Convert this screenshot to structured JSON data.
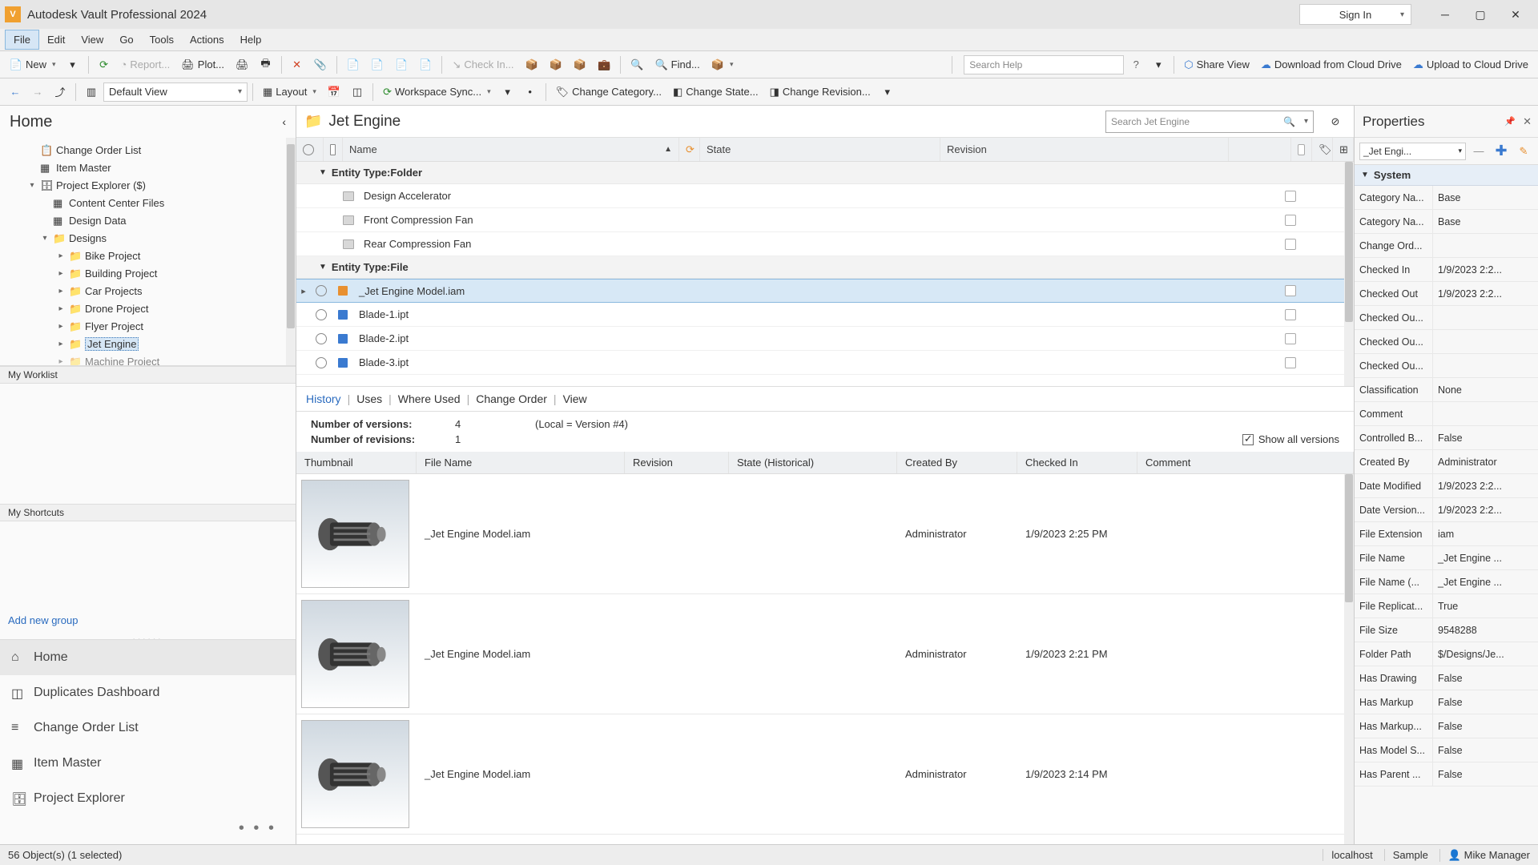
{
  "app": {
    "title": "Autodesk Vault Professional 2024",
    "signin": "Sign In"
  },
  "menu": {
    "file": "File",
    "edit": "Edit",
    "view": "View",
    "go": "Go",
    "tools": "Tools",
    "actions": "Actions",
    "help": "Help"
  },
  "toolbar": {
    "new": "New",
    "report": "Report...",
    "plot": "Plot...",
    "checkin": "Check In...",
    "find": "Find...",
    "search_help_ph": "Search Help",
    "share_view": "Share View",
    "download_cloud": "Download from Cloud Drive",
    "upload_cloud": "Upload to Cloud Drive"
  },
  "toolbar2": {
    "view_select": "Default View",
    "layout": "Layout",
    "workspace_sync": "Workspace Sync...",
    "change_category": "Change Category...",
    "change_state": "Change State...",
    "change_revision": "Change Revision..."
  },
  "left": {
    "home": "Home",
    "tree": {
      "col": "Change Order List",
      "item_master": "Item Master",
      "proj_explorer": "Project Explorer ($)",
      "content_center": "Content Center Files",
      "design_data": "Design Data",
      "designs": "Designs",
      "bike": "Bike Project",
      "building": "Building Project",
      "car": "Car Projects",
      "drone": "Drone Project",
      "flyer": "Flyer Project",
      "jet": "Jet Engine",
      "machine": "Machine Project"
    },
    "worklist": "My Worklist",
    "shortcuts": "My Shortcuts",
    "add_group": "Add new group",
    "nav": {
      "home": "Home",
      "dup": "Duplicates Dashboard",
      "col": "Change Order List",
      "item": "Item Master",
      "proj": "Project Explorer"
    }
  },
  "center": {
    "title": "Jet Engine",
    "search_ph": "Search Jet Engine",
    "cols": {
      "name": "Name",
      "state": "State",
      "revision": "Revision"
    },
    "groups": {
      "folder": "Entity Type:Folder",
      "file": "Entity Type:File"
    },
    "rows": {
      "design_accel": "Design Accelerator",
      "front_fan": "Front Compression Fan",
      "rear_fan": "Rear Compression Fan",
      "jet_model": "_Jet Engine Model.iam",
      "blade1": "Blade-1.ipt",
      "blade2": "Blade-2.ipt",
      "blade3": "Blade-3.ipt"
    },
    "tabs": {
      "history": "History",
      "uses": "Uses",
      "where_used": "Where Used",
      "change_order": "Change Order",
      "view": "View"
    },
    "meta": {
      "versions_lbl": "Number of versions:",
      "versions_val": "4",
      "local_version": "(Local = Version #4)",
      "revisions_lbl": "Number of revisions:",
      "revisions_val": "1",
      "show_all": "Show all versions"
    },
    "hist_cols": {
      "thumb": "Thumbnail",
      "file": "File Name",
      "rev": "Revision",
      "state": "State (Historical)",
      "created_by": "Created By",
      "checked_in": "Checked In",
      "comment": "Comment"
    },
    "hist": [
      {
        "file": "_Jet Engine Model.iam",
        "by": "Administrator",
        "checked_in": "1/9/2023 2:25 PM"
      },
      {
        "file": "_Jet Engine Model.iam",
        "by": "Administrator",
        "checked_in": "1/9/2023 2:21 PM"
      },
      {
        "file": "_Jet Engine Model.iam",
        "by": "Administrator",
        "checked_in": "1/9/2023 2:14 PM"
      }
    ]
  },
  "props": {
    "title": "Properties",
    "selected": "_Jet Engi...",
    "system": "System",
    "rows": [
      {
        "n": "Category Na...",
        "v": "Base"
      },
      {
        "n": "Category Na...",
        "v": "Base"
      },
      {
        "n": "Change Ord...",
        "v": ""
      },
      {
        "n": "Checked In",
        "v": "1/9/2023 2:2..."
      },
      {
        "n": "Checked Out",
        "v": "1/9/2023 2:2..."
      },
      {
        "n": "Checked Ou...",
        "v": ""
      },
      {
        "n": "Checked Ou...",
        "v": ""
      },
      {
        "n": "Checked Ou...",
        "v": ""
      },
      {
        "n": "Classification",
        "v": "None"
      },
      {
        "n": "Comment",
        "v": ""
      },
      {
        "n": "Controlled B...",
        "v": "False"
      },
      {
        "n": "Created By",
        "v": "Administrator"
      },
      {
        "n": "Date Modified",
        "v": "1/9/2023 2:2..."
      },
      {
        "n": "Date Version...",
        "v": "1/9/2023 2:2..."
      },
      {
        "n": "File Extension",
        "v": "iam"
      },
      {
        "n": "File Name",
        "v": "_Jet Engine ..."
      },
      {
        "n": "File Name (...",
        "v": "_Jet Engine ..."
      },
      {
        "n": "File Replicat...",
        "v": "True"
      },
      {
        "n": "File Size",
        "v": "9548288"
      },
      {
        "n": "Folder Path",
        "v": "$/Designs/Je..."
      },
      {
        "n": "Has Drawing",
        "v": "False"
      },
      {
        "n": "Has Markup",
        "v": "False"
      },
      {
        "n": "Has Markup...",
        "v": "False"
      },
      {
        "n": "Has Model S...",
        "v": "False"
      },
      {
        "n": "Has Parent ...",
        "v": "False"
      }
    ]
  },
  "status": {
    "count": "56 Object(s) (1 selected)",
    "host": "localhost",
    "sample": "Sample",
    "user": "Mike Manager"
  }
}
